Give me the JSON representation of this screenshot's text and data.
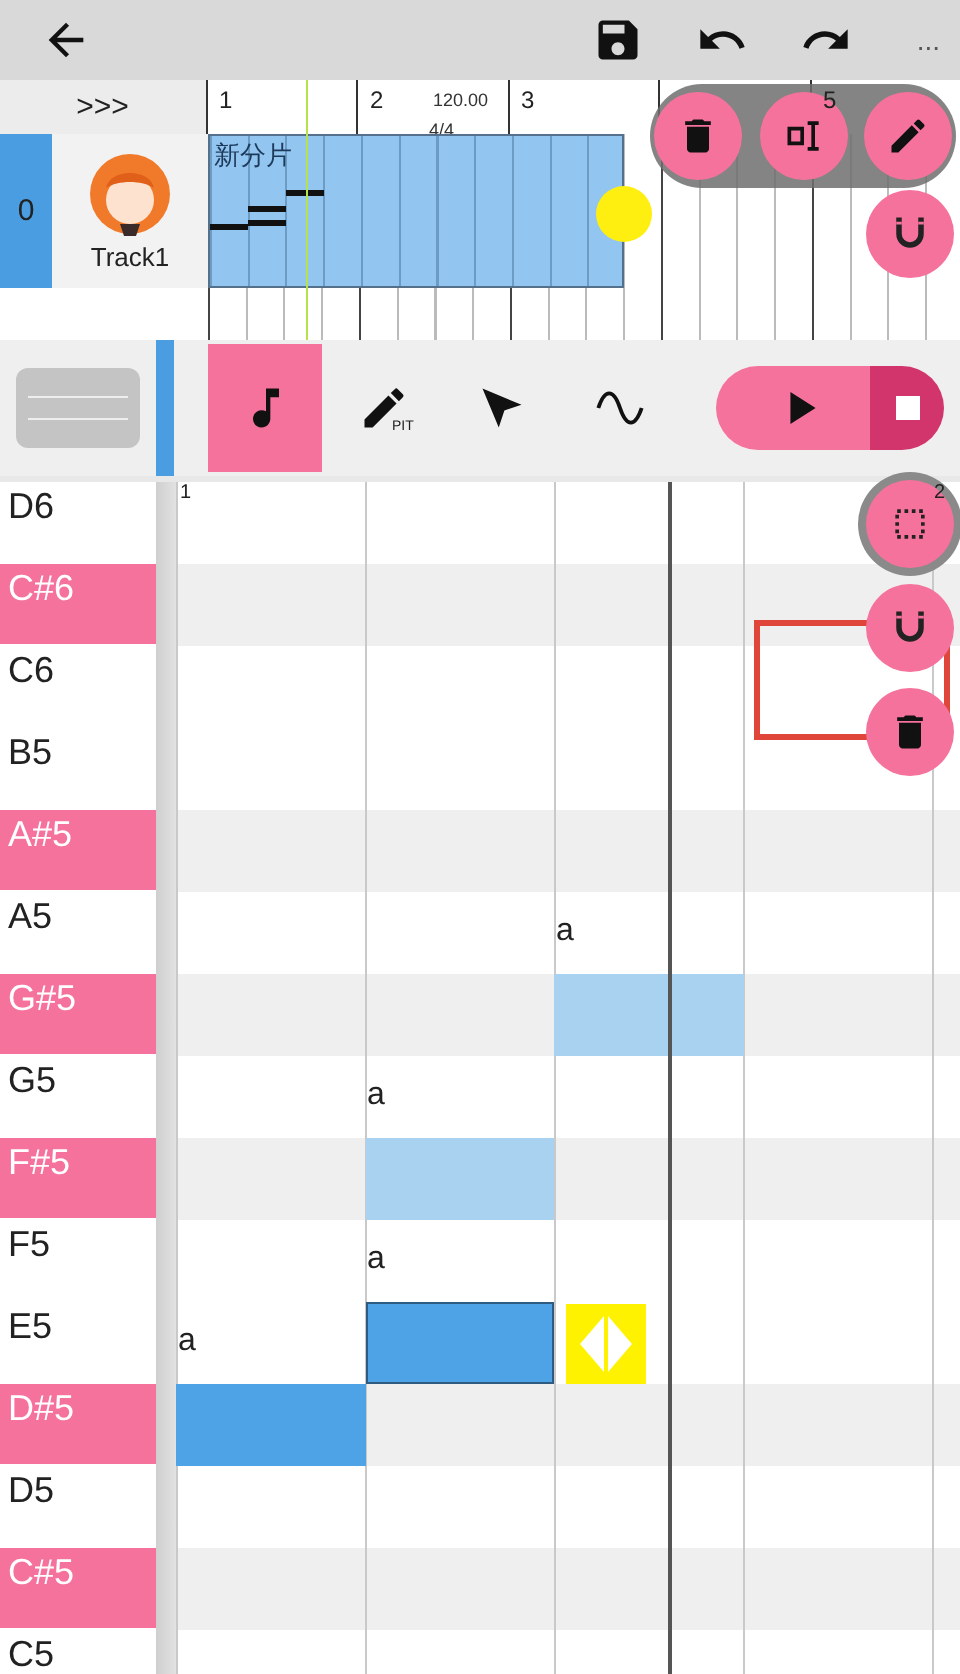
{
  "app_bar": {
    "more_label": "..."
  },
  "timeline": {
    "expand_label": ">>>",
    "tempo": "120.00",
    "time_signature": "4/4",
    "measures": [
      {
        "kind": "numbered",
        "label": "1"
      },
      {
        "kind": "numbered",
        "label": "2"
      },
      {
        "kind": "numbered",
        "label": "3"
      },
      {
        "kind": "covered"
      },
      {
        "kind": "numbered",
        "label": "5"
      }
    ],
    "tracks": [
      {
        "number": "0",
        "name": "Track1",
        "clip": {
          "title": "新分片"
        }
      }
    ],
    "clip_tools": [
      {
        "kind": "delete"
      },
      {
        "kind": "cursor"
      },
      {
        "kind": "edit"
      }
    ],
    "snap": {
      "kind": "magnet"
    }
  },
  "tools": [
    {
      "kind": "note",
      "selected": true
    },
    {
      "kind": "pitch",
      "label": "PIT",
      "selected": false
    },
    {
      "kind": "pointer",
      "selected": false
    },
    {
      "kind": "curve",
      "selected": false
    }
  ],
  "piano_roll": {
    "bar_labels": [
      "1",
      "2"
    ],
    "side_buttons": [
      {
        "kind": "select",
        "ring": true,
        "highlighted": false
      },
      {
        "kind": "magnet",
        "ring": false,
        "highlighted": true
      },
      {
        "kind": "delete",
        "ring": false,
        "highlighted": false
      }
    ],
    "keys": [
      {
        "label": "D6",
        "black": false
      },
      {
        "label": "C#6",
        "black": true
      },
      {
        "label": "C6",
        "black": false
      },
      {
        "label": "B5",
        "black": false
      },
      {
        "label": "A#5",
        "black": true
      },
      {
        "label": "A5",
        "black": false,
        "cells": [
          {
            "kind": "empty"
          },
          {
            "kind": "empty"
          },
          {
            "kind": "empty",
            "lyric": "a"
          }
        ]
      },
      {
        "label": "G#5",
        "black": true,
        "cells": [
          {
            "kind": "empty"
          },
          {
            "kind": "empty"
          },
          {
            "kind": "ghost",
            "selected": false
          }
        ]
      },
      {
        "label": "G5",
        "black": false,
        "cells": [
          {
            "kind": "empty"
          },
          {
            "kind": "empty",
            "lyric": "a"
          }
        ]
      },
      {
        "label": "F#5",
        "black": true,
        "cells": [
          {
            "kind": "empty"
          },
          {
            "kind": "ghost",
            "selected": false
          }
        ]
      },
      {
        "label": "F5",
        "black": false,
        "cells": [
          {
            "kind": "empty"
          },
          {
            "kind": "empty",
            "lyric": "a"
          }
        ]
      },
      {
        "label": "E5",
        "black": false,
        "cells": [
          {
            "kind": "empty",
            "lyric": "a"
          },
          {
            "kind": "note",
            "selected": true
          },
          {
            "kind": "handle"
          }
        ]
      },
      {
        "label": "D#5",
        "black": true,
        "cells": [
          {
            "kind": "note",
            "selected": false
          }
        ]
      },
      {
        "label": "D5",
        "black": false
      },
      {
        "label": "C#5",
        "black": true
      },
      {
        "label": "C5",
        "black": false
      }
    ]
  }
}
